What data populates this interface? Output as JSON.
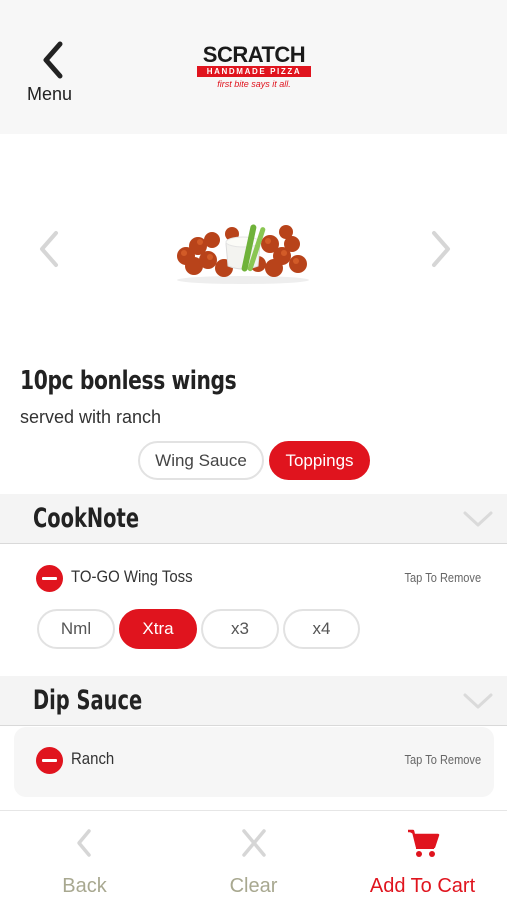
{
  "header": {
    "menu_label": "Menu",
    "logo": {
      "name": "SCRATCH",
      "sub": "HANDMADE PIZZA",
      "tagline": "first bite says it all."
    }
  },
  "gallery": {
    "prev_icon": "chevron-left-icon",
    "next_icon": "chevron-right-icon",
    "image": "boneless-wings-with-ranch-and-celery"
  },
  "item": {
    "title": "10pc bonless wings",
    "subtitle": "served with ranch"
  },
  "tabs": [
    {
      "label": "Wing Sauce",
      "active": false
    },
    {
      "label": "Toppings",
      "active": true
    }
  ],
  "sections": {
    "cooknote": {
      "title": "CookNote",
      "item": {
        "label": "TO-GO Wing Toss",
        "action": "Tap To Remove"
      },
      "options": [
        {
          "label": "Nml",
          "selected": false
        },
        {
          "label": "Xtra",
          "selected": true
        },
        {
          "label": "x3",
          "selected": false
        },
        {
          "label": "x4",
          "selected": false
        }
      ]
    },
    "dip": {
      "title": "Dip Sauce",
      "item": {
        "label": "Ranch",
        "action": "Tap To Remove"
      }
    }
  },
  "bottom_nav": {
    "back_label": "Back",
    "clear_label": "Clear",
    "cart_label": "Add To Cart"
  },
  "colors": {
    "accent": "#e0141e",
    "inactive": "#a8a890",
    "section_bg": "#f4f4f4"
  }
}
